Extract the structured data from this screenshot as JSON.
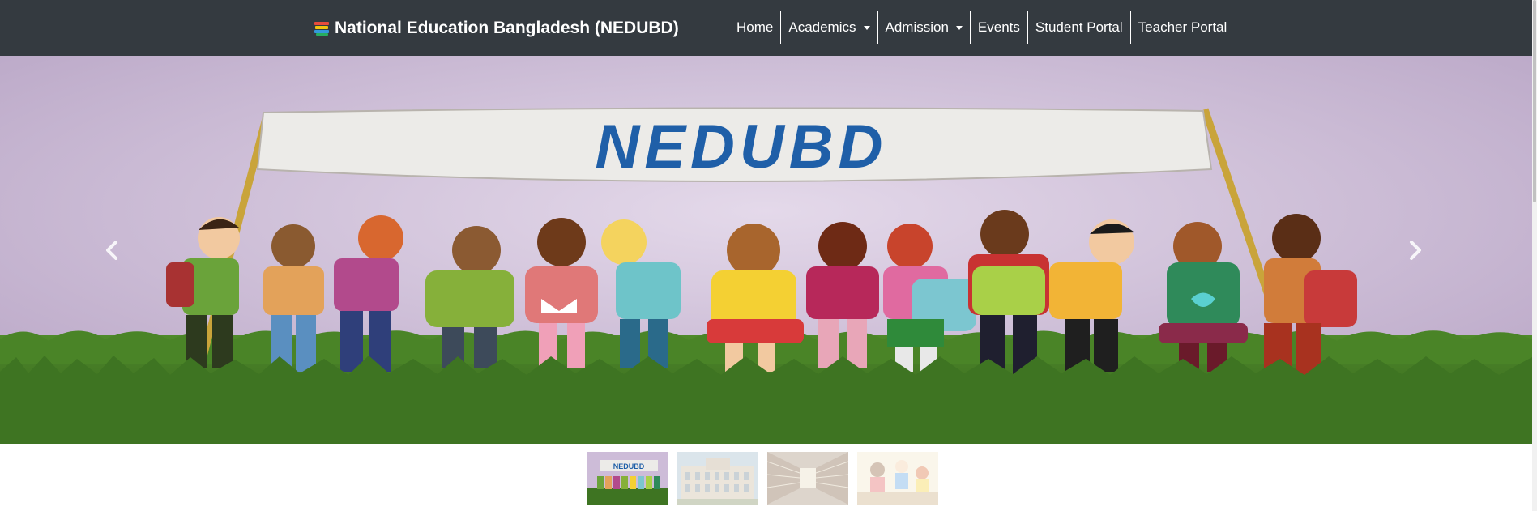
{
  "navbar": {
    "brand_icon": "books-icon",
    "brand_text": "National Education Bangladesh (NEDUBD)",
    "background_color": "#343a40",
    "items": [
      {
        "label": "Home",
        "dropdown": false
      },
      {
        "label": "Academics",
        "dropdown": true
      },
      {
        "label": "Admission",
        "dropdown": true
      },
      {
        "label": "Events",
        "dropdown": false
      },
      {
        "label": "Student Portal",
        "dropdown": false
      },
      {
        "label": "Teacher Portal",
        "dropdown": false
      }
    ]
  },
  "carousel": {
    "banner_text": "NEDUBD",
    "banner_text_color": "#1f5fa8",
    "prev_icon": "chevron-left-icon",
    "next_icon": "chevron-right-icon",
    "active_slide": 1,
    "slide_count": 4
  },
  "thumbnails": [
    {
      "name": "thumbnail-nedubd-kids",
      "banner_text": "NEDUBD",
      "active": true
    },
    {
      "name": "thumbnail-building",
      "active": false
    },
    {
      "name": "thumbnail-library",
      "active": false
    },
    {
      "name": "thumbnail-classroom",
      "active": false
    }
  ]
}
